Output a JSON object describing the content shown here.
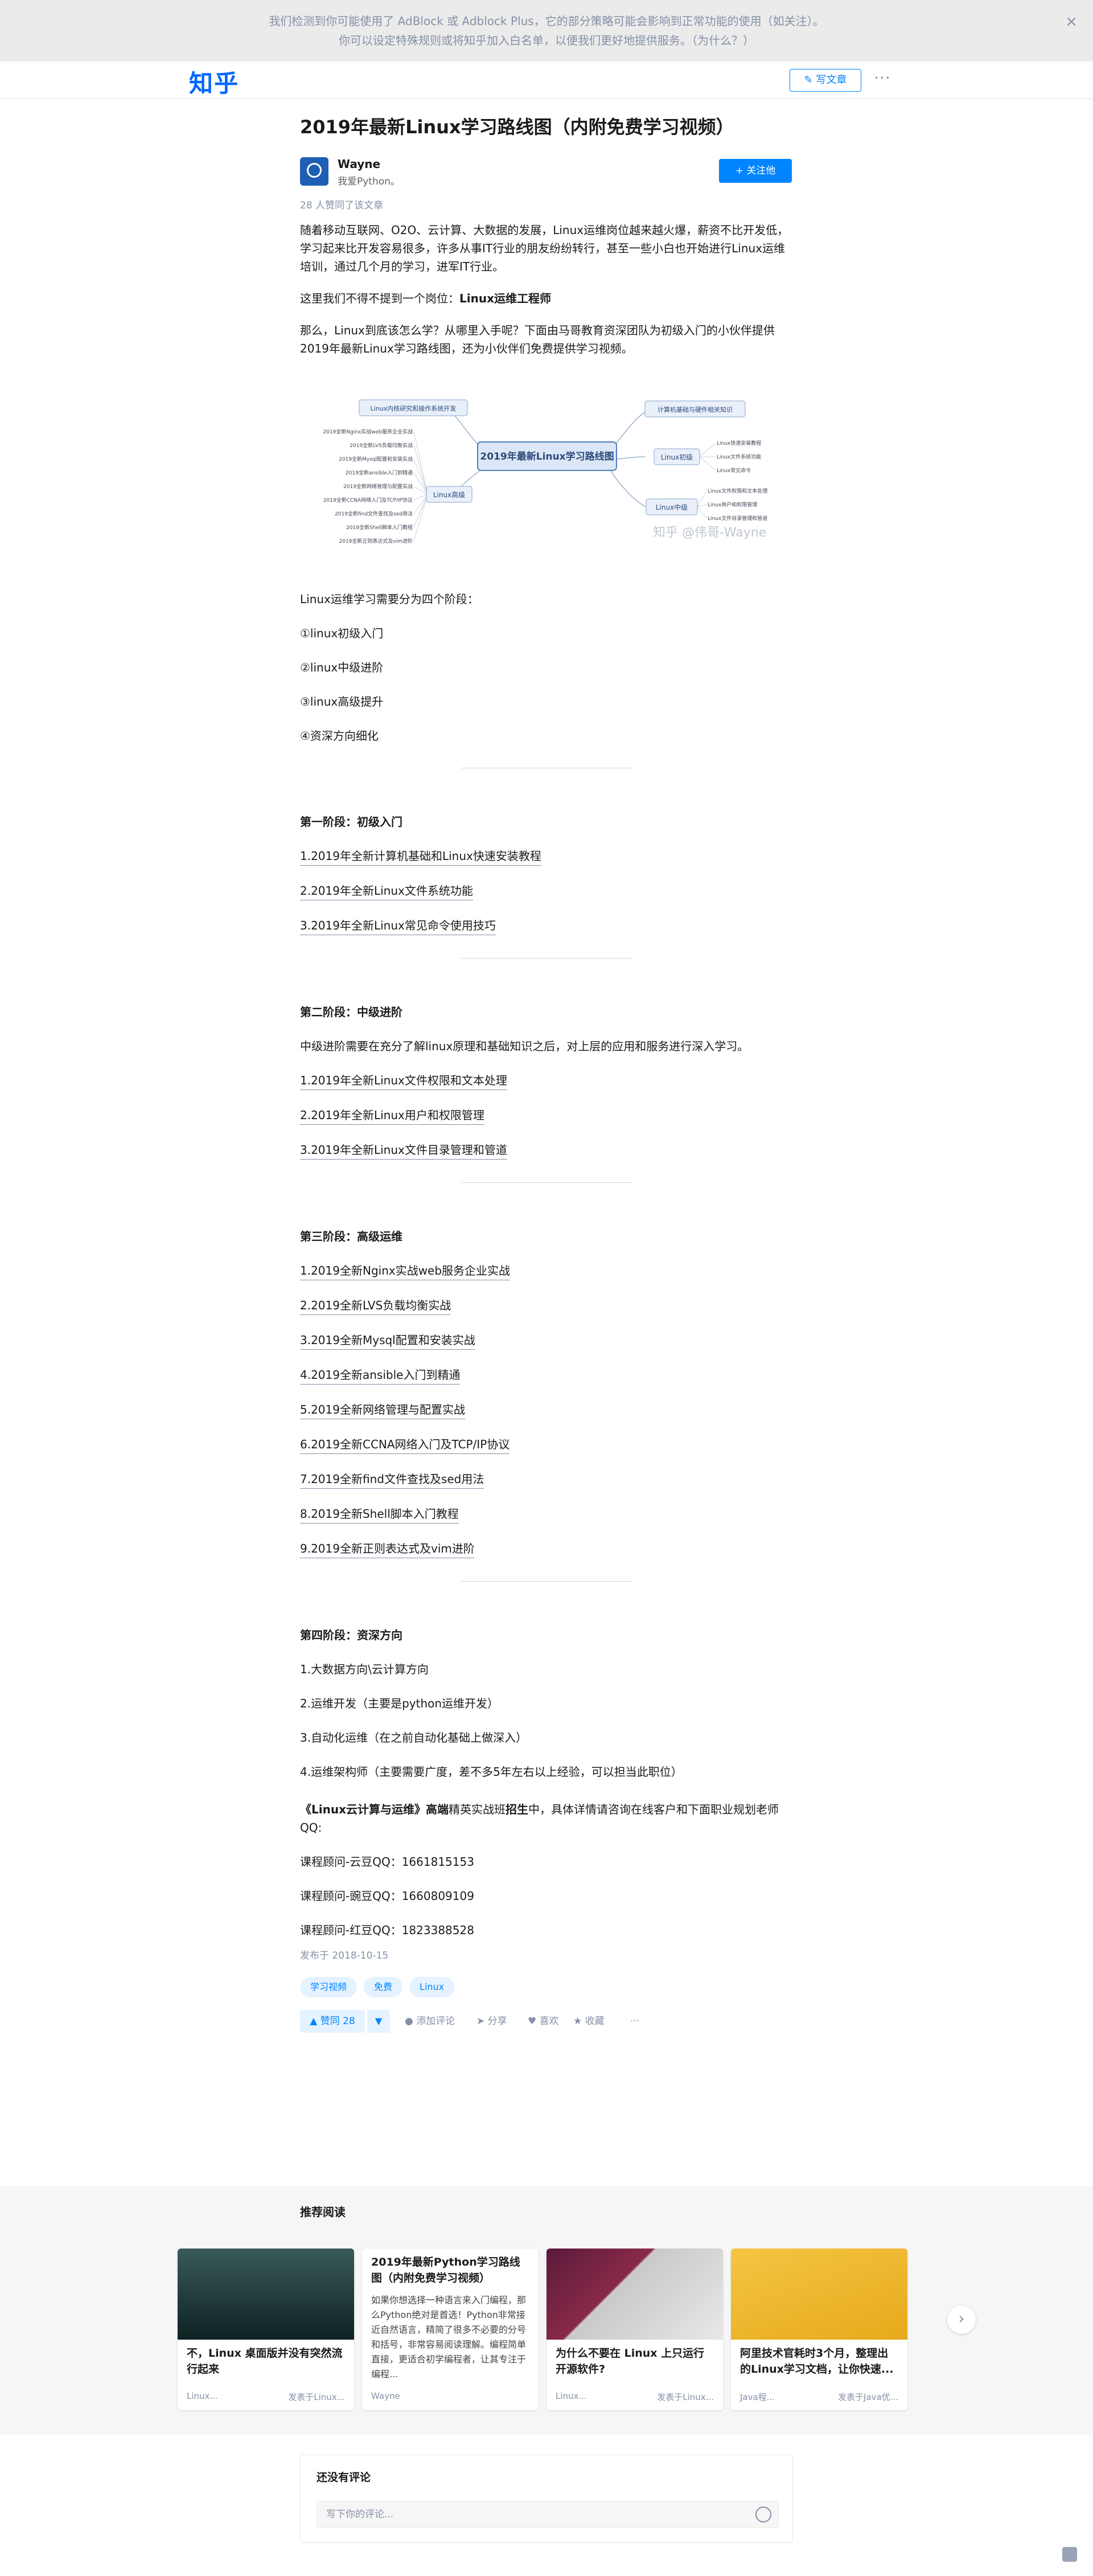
{
  "notice": {
    "line1": "我们检测到你可能使用了 AdBlock 或 Adblock Plus，它的部分策略可能会影响到正常功能的使用（如关注）。",
    "line2": "你可以设定特殊规则或将知乎加入白名单，以便我们更好地提供服务。（为什么？）",
    "close": "×"
  },
  "header": {
    "logo": "知乎",
    "write_label": "写文章",
    "more": "···"
  },
  "article": {
    "title": "2019年最新Linux学习路线图（内附免费学习视频）",
    "author_name": "Wayne",
    "author_bio": "我爱Python。",
    "follow_label": "关注他",
    "likes_meta": "28 人赞同了该文章",
    "intro": "随着移动互联网、O2O、云计算、大数据的发展，Linux运维岗位越来越火爆，薪资不比开发低，学习起来比开发容易很多，许多从事IT行业的朋友纷纷转行，甚至一些小白也开始进行Linux运维培训，通过几个月的学习，进军IT行业。",
    "p2_prefix": "这里我们不得不提到一个岗位：",
    "p2_bold": "Linux运维工程师",
    "p3": "那么，Linux到底该怎么学？从哪里入手呢？下面由马哥教育资深团队为初级入门的小伙伴提供2019年最新Linux学习路线图，还为小伙伴们免费提供学习视频。",
    "stages_intro": "Linux运维学习需要分为四个阶段：",
    "stages": [
      "①linux初级入门",
      "②linux中级进阶",
      "③linux高级提升",
      "④资深方向细化"
    ],
    "s1_title": "第一阶段：初级入门",
    "s1_links": [
      "1.2019年全新计算机基础和Linux快速安装教程",
      "2.2019年全新Linux文件系统功能",
      "3.2019年全新Linux常见命令使用技巧"
    ],
    "s2_title": "第二阶段：中级进阶",
    "s2_desc": "中级进阶需要在充分了解linux原理和基础知识之后，对上层的应用和服务进行深入学习。",
    "s2_links": [
      "1.2019年全新Linux文件权限和文本处理",
      "2.2019年全新Linux用户和权限管理",
      "3.2019年全新Linux文件目录管理和管道"
    ],
    "s3_title": "第三阶段：高级运维",
    "s3_links": [
      "1.2019全新Nginx实战web服务企业实战",
      "2.2019全新LVS负载均衡实战",
      "3.2019全新Mysql配置和安装实战",
      "4.2019全新ansible入门到精通",
      "5.2019全新网络管理与配置实战",
      "6.2019全新CCNA网络入门及TCP/IP协议",
      "7.2019全新find文件查找及sed用法",
      "8.2019全新Shell脚本入门教程",
      "9.2019全新正则表达式及vim进阶"
    ],
    "s4_title": "第四阶段：资深方向",
    "s4_items": [
      "1.大数据方向\\云计算方向",
      "2.运维开发（主要是python运维开发）",
      "3.自动化运维（在之前自动化基础上做深入）",
      "4.运维架构师（主要需要广度，差不多5年左右以上经验，可以担当此职位）"
    ],
    "promo_b1": "《Linux云计算与运维》高端",
    "promo_n1": "精英实战班",
    "promo_b2": "招生",
    "promo_n2": "中，具体详情请咨询在线客户和下面职业规划老师QQ:",
    "qq": [
      "课程顾问-云豆QQ：1661815153",
      "课程顾问-豌豆QQ：1660809109",
      "课程顾问-红豆QQ：1823388528"
    ],
    "published": "发布于 2018-10-15",
    "tags": [
      "学习视频",
      "免费",
      "Linux"
    ],
    "vote_up": "▲ 赞同 28",
    "vote_down": "▼",
    "actions": [
      "添加评论",
      "分享",
      "喜欢",
      "收藏",
      "···"
    ]
  },
  "mindmap": {
    "center": "2019年最新Linux学习路线图",
    "left_top": "Linux内核研究和操作系统开发",
    "left_mid": "Linux高级",
    "left_items": [
      "2019全新Nginx实战web服务企业实战",
      "2019全新LVS负载均衡实战",
      "2019全新Mysql配置和安装实战",
      "2019全新ansible入门到精通",
      "2019全新网络管理与配置实战",
      "2019全新CCNA网络入门及TCP/IP协议",
      "2019全新find文件查找及sed用法",
      "2019全新Shell脚本入门教程",
      "2019全新正则表达式及vim进阶"
    ],
    "right_top": "计算机基础与硬件相关知识",
    "right_mid": "Linux初级",
    "right_mid_items": [
      "Linux快速安装教程",
      "Linux文件系统功能",
      "Linux常见命令"
    ],
    "right_bot": "Linux中级",
    "right_bot_items": [
      "Linux文件权限和文本处理",
      "Linux用户和权限管理",
      "Linux文件目录管理和管道"
    ],
    "watermark": "知乎 @伟哥-Wayne"
  },
  "recommend": {
    "title": "推荐阅读",
    "cards": [
      {
        "title": "不，Linux 桌面版并没有突然流行起来",
        "author": "Linux...",
        "source": "发表于Linux..."
      },
      {
        "title": "2019年最新Python学习路线图（内附免费学习视频）",
        "desc": "如果你想选择一种语言来入门编程，那么Python绝对是首选！Python非常接近自然语言，精简了很多不必要的分号和括号，非常容易阅读理解。编程简单直接，更适合初学编程者，让其专注于编程...",
        "author": "Wayne",
        "source": ""
      },
      {
        "title": "为什么不要在 Linux 上只运行开源软件?",
        "author": "Linux...",
        "source": "发表于Linux..."
      },
      {
        "title": "阿里技术官耗时3个月，整理出的Linux学习文档，让你快速...",
        "author": "Java程...",
        "source": "发表于Java优..."
      }
    ],
    "next": "›"
  },
  "comments": {
    "title": "还没有评论",
    "placeholder": "写下你的评论..."
  },
  "colors": {
    "brand": "#0066ff",
    "accent": "#0084ff",
    "muted": "#8590a6"
  }
}
